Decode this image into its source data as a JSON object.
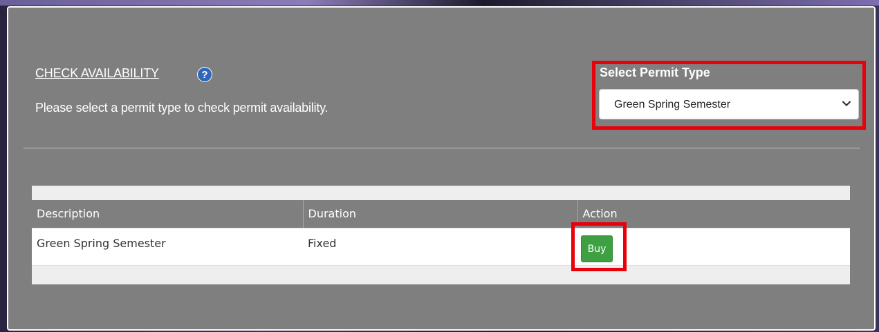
{
  "availability": {
    "title": "CHECK AVAILABILITY",
    "help_icon_glyph": "?",
    "instructions": "Please select a permit type to check permit availability."
  },
  "permit_type": {
    "label": "Select Permit Type",
    "selected": "Green Spring Semester"
  },
  "table": {
    "headers": [
      "Description",
      "Duration",
      "Action"
    ],
    "rows": [
      {
        "description": "Green Spring Semester",
        "duration": "Fixed",
        "action_label": "Buy"
      }
    ]
  },
  "colors": {
    "panel_bg": "#7f7f7f",
    "highlight": "#e8000a",
    "buy_button": "#3ea043",
    "help_icon": "#2f66b8"
  },
  "icons": [
    "help-icon",
    "chevron-down-icon"
  ]
}
